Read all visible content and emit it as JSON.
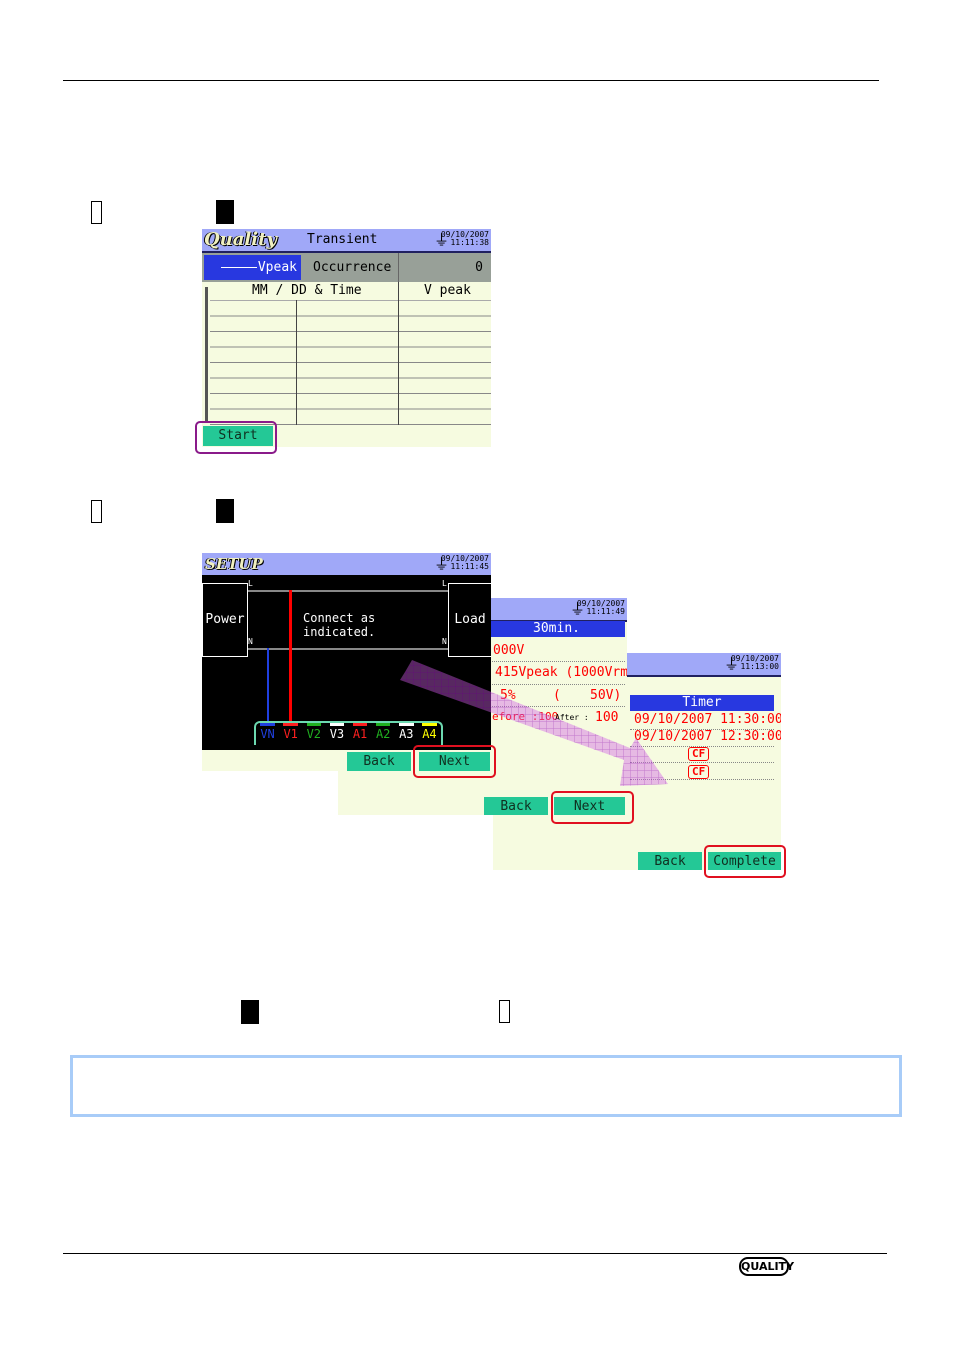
{
  "screen_transient": {
    "logo": "Quality",
    "title": "Transient",
    "date": "09/10/2007",
    "time": "11:11:38",
    "tab_active": "Vpeak",
    "tab_occurrence": "Occurrence",
    "count": "0",
    "col_time": "MM / DD & Time",
    "col_vpeak": "V peak",
    "start_label": "Start"
  },
  "screen_setup": {
    "logo": "SETUP",
    "date": "09/10/2007",
    "time": "11:11:45",
    "power": "Power",
    "load": "Load",
    "line_l": "L",
    "line_n": "N",
    "message_1": "Connect as",
    "message_2": "indicated.",
    "terminals": [
      {
        "label": "VN",
        "color": "#2040e0"
      },
      {
        "label": "V1",
        "color": "#ff2020"
      },
      {
        "label": "V2",
        "color": "#20b020"
      },
      {
        "label": "V3",
        "color": "#ffffff"
      },
      {
        "label": "A1",
        "color": "#ff2020"
      },
      {
        "label": "A2",
        "color": "#20b020"
      },
      {
        "label": "A3",
        "color": "#ffffff"
      },
      {
        "label": "A4",
        "color": "#ffff00"
      }
    ],
    "back_label": "Back",
    "next_label": "Next"
  },
  "screen_settings": {
    "date": "09/10/2007",
    "time": "11:11:49",
    "interval": "30min.",
    "row1": "000V",
    "row2": "415Vpeak (1000Vrms)",
    "row3_a": "5%",
    "row3_b": "(",
    "row3_c": "50V)",
    "row4_a": "efore :100",
    "row4_b": "After :",
    "row4_c": "100",
    "back_label": "Back",
    "next_label": "Next"
  },
  "screen_timer": {
    "date": "09/10/2007",
    "time": "11:13:00",
    "timer_header": "Timer",
    "start_time": "09/10/2007 11:30:00",
    "end_time": "09/10/2007 12:30:00",
    "cf1": "CF",
    "cf2": "CF",
    "back_label": "Back",
    "complete_label": "Complete"
  },
  "footer": {
    "logo": "QUALITY"
  },
  "colors": {
    "accent_red": "#e01020",
    "highlight_purple": "#8a1a8a",
    "button_green": "#24c896",
    "title_bar": "#a0a8f8",
    "note_border": "#a8ccf8"
  }
}
